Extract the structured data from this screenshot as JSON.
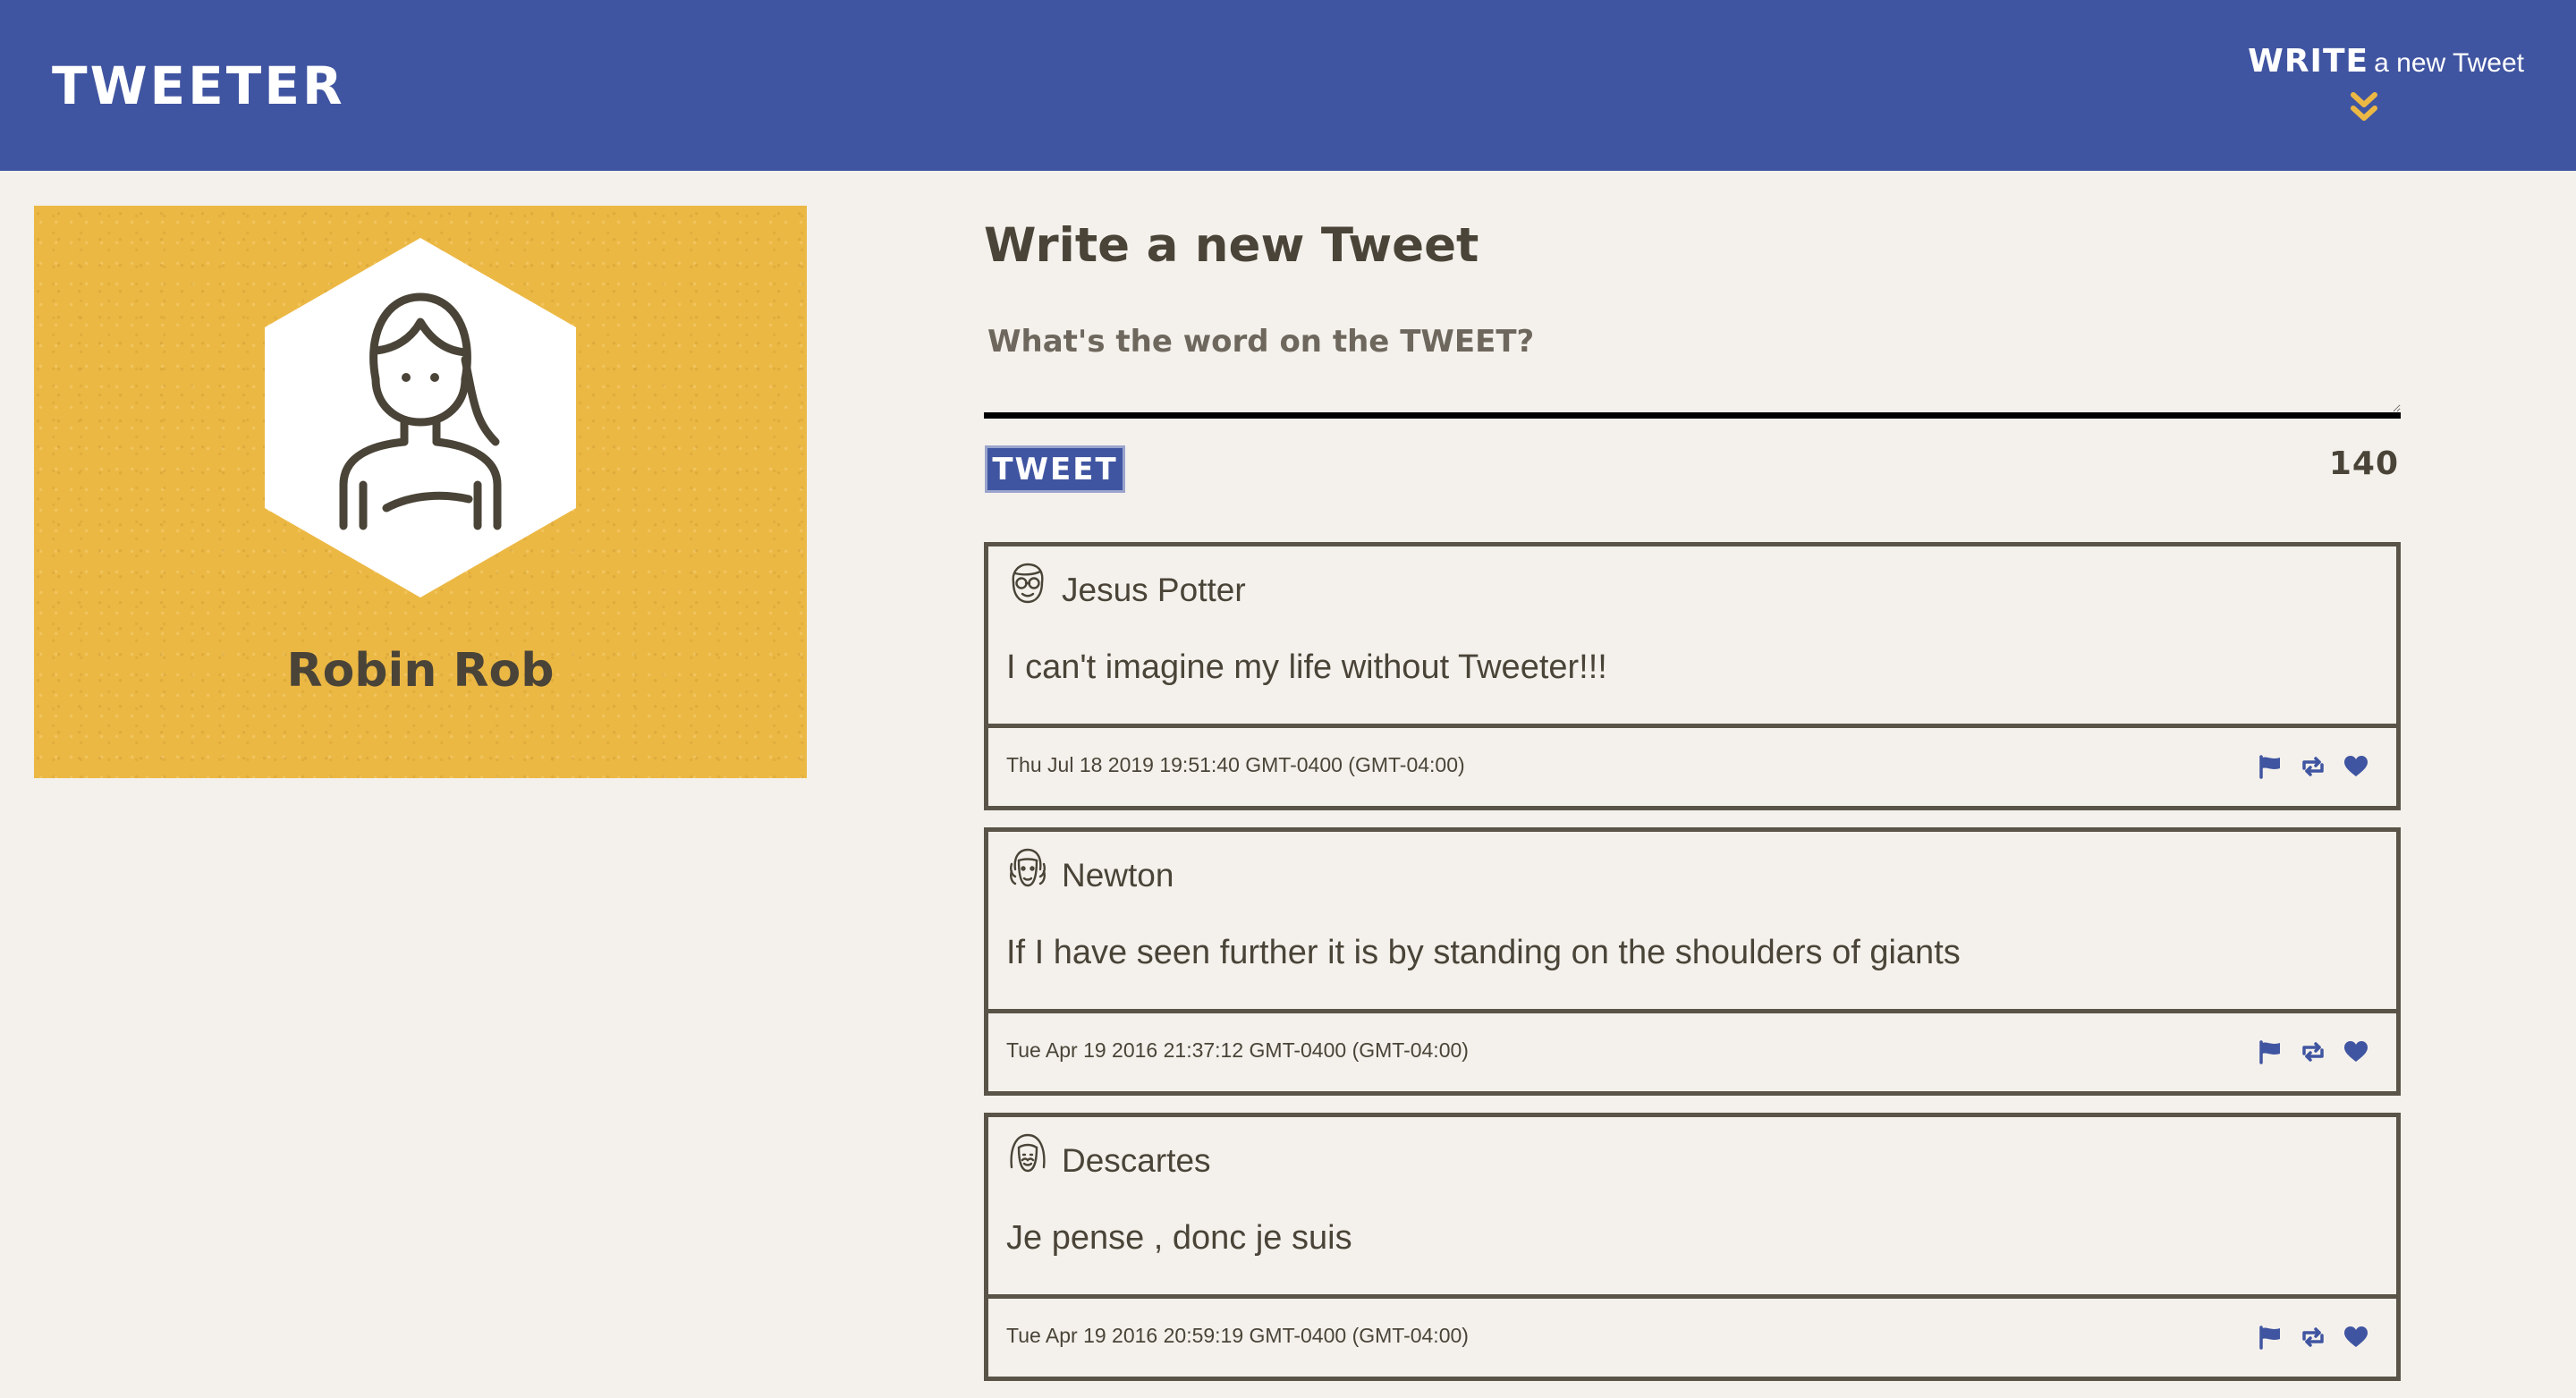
{
  "app": {
    "brand": "TWEETER",
    "compose_toggle": {
      "bold_label": "WRITE",
      "rest_label": "a new Tweet",
      "icon": "chevron-double-down-icon"
    }
  },
  "colors": {
    "primary": "#4055a1",
    "accent": "#ecb844",
    "background": "#f4f1ec",
    "text": "#4a4438"
  },
  "profile": {
    "name": "Robin Rob",
    "avatar_icon": "user-avatar-icon"
  },
  "compose": {
    "title": "Write a new Tweet",
    "placeholder": "What's the word on the TWEET?",
    "value": "",
    "submit_label": "TWEET",
    "counter": "140"
  },
  "tweets": [
    {
      "author": "Jesus Potter",
      "avatar_icon": "glasses-face-icon",
      "content": "I can't imagine my life without Tweeter!!!",
      "timestamp": "Thu Jul 18 2019 19:51:40 GMT-0400 (GMT-04:00)",
      "actions": [
        "flag-icon",
        "retweet-icon",
        "heart-icon"
      ]
    },
    {
      "author": "Newton",
      "avatar_icon": "wig-face-icon",
      "content": "If I have seen further it is by standing on the shoulders of giants",
      "timestamp": "Tue Apr 19 2016 21:37:12 GMT-0400 (GMT-04:00)",
      "actions": [
        "flag-icon",
        "retweet-icon",
        "heart-icon"
      ]
    },
    {
      "author": "Descartes",
      "avatar_icon": "longhair-face-icon",
      "content": "Je pense , donc je suis",
      "timestamp": "Tue Apr 19 2016 20:59:19 GMT-0400 (GMT-04:00)",
      "actions": [
        "flag-icon",
        "retweet-icon",
        "heart-icon"
      ]
    }
  ]
}
